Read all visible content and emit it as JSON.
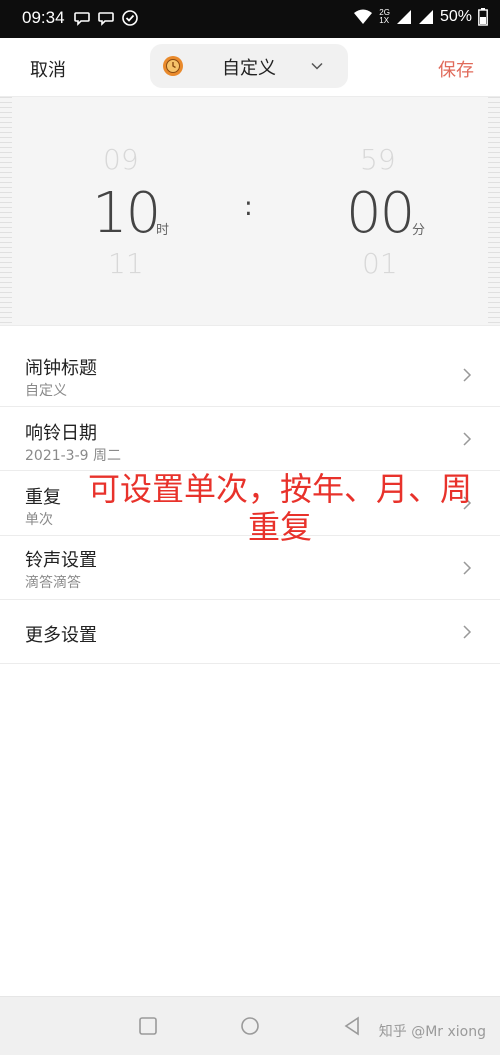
{
  "status_bar": {
    "time": "09:34",
    "network_top": "2G",
    "network_bottom": "1X",
    "battery": "50%"
  },
  "header": {
    "cancel_label": "取消",
    "save_label": "保存",
    "type_label": "自定义",
    "accent_color": "#e06a5a"
  },
  "picker": {
    "hour_prev": "09",
    "hour": "10",
    "hour_next": "11",
    "hour_unit": "时",
    "separator": ":",
    "minute_prev": "59",
    "minute": "00",
    "minute_next": "01",
    "minute_unit": "分"
  },
  "settings": [
    {
      "title": "闹钟标题",
      "subtitle": "自定义"
    },
    {
      "title": "响铃日期",
      "subtitle": "2021-3-9 周二"
    },
    {
      "title": "重复",
      "subtitle": "单次"
    },
    {
      "title": "铃声设置",
      "subtitle": "滴答滴答"
    },
    {
      "title": "更多设置",
      "subtitle": ""
    }
  ],
  "annotation": {
    "line1": "可设置单次，按年、月、周",
    "line2": "重复",
    "color": "#e8322b"
  },
  "watermark": "知乎 @Mr xiong"
}
